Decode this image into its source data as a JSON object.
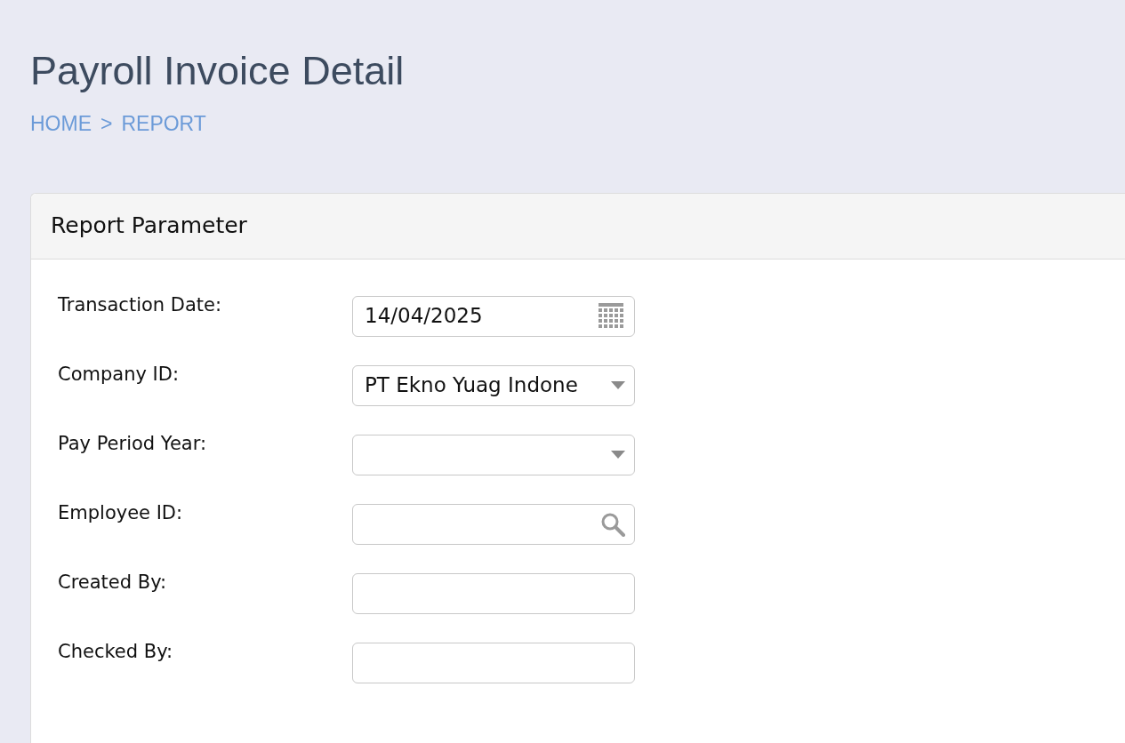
{
  "page_title": "Payroll Invoice Detail",
  "breadcrumb": [
    {
      "label": "HOME"
    },
    {
      "label": "REPORT"
    }
  ],
  "breadcrumb_separator": ">",
  "panel": {
    "title": "Report Parameter",
    "fields": [
      {
        "label": "Transaction Date:",
        "kind": "date",
        "value": "14/04/2025"
      },
      {
        "label": "Company ID:",
        "kind": "select",
        "value": "PT Ekno Yuag Indone"
      },
      {
        "label": "Pay Period Year:",
        "kind": "select"
      },
      {
        "label": "Employee ID:",
        "kind": "lookup"
      },
      {
        "label": "Created By:",
        "kind": "text"
      },
      {
        "label": "Checked By:",
        "kind": "text"
      }
    ]
  }
}
